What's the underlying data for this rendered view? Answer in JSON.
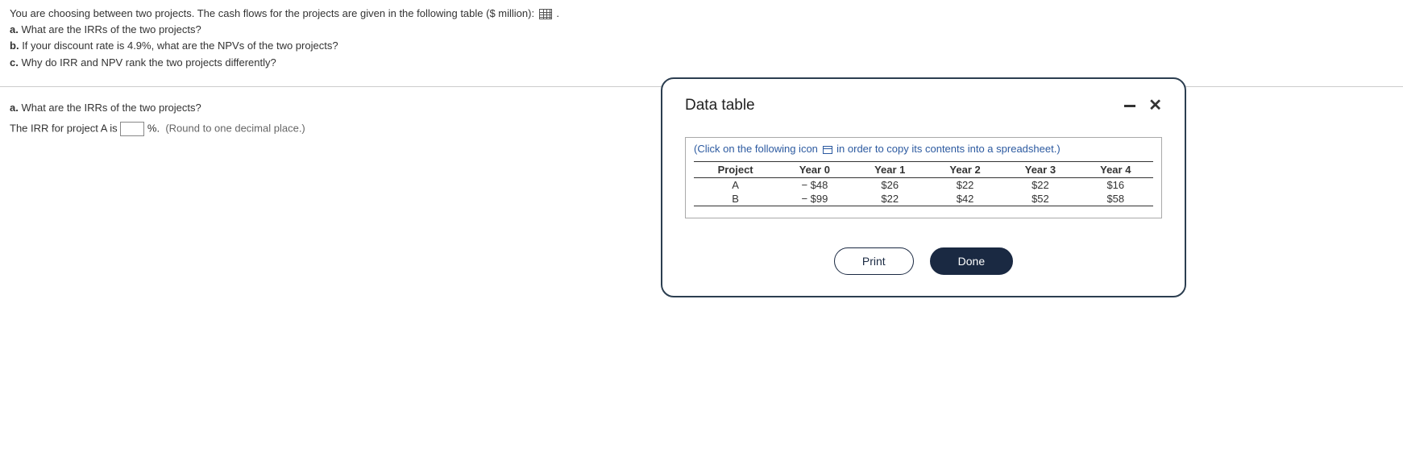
{
  "header": {
    "intro": "You are choosing between two projects. The cash flows for the projects are given in the following table ($ million):",
    "qa_label": "a.",
    "qa_text": "What are the IRRs of the two projects?",
    "qb_label": "b.",
    "qb_text": "If your discount rate is 4.9%, what are the NPVs of the two projects?",
    "qc_label": "c.",
    "qc_text": "Why do IRR and NPV rank the two projects differently?"
  },
  "content": {
    "section_label": "a.",
    "section_text": "What are the IRRs of the two projects?",
    "answer_pre": "The IRR for project A is",
    "answer_post": "%.",
    "hint": "(Round to one decimal place.)",
    "input_value": ""
  },
  "modal": {
    "title": "Data table",
    "copy_hint_pre": "(Click on the following icon",
    "copy_hint_post": "in order to copy its contents into a spreadsheet.)",
    "table": {
      "headers": [
        "Project",
        "Year 0",
        "Year 1",
        "Year 2",
        "Year 3",
        "Year 4"
      ],
      "rows": [
        [
          "A",
          "− $48",
          "$26",
          "$22",
          "$22",
          "$16"
        ],
        [
          "B",
          "− $99",
          "$22",
          "$42",
          "$52",
          "$58"
        ]
      ]
    },
    "print_label": "Print",
    "done_label": "Done"
  },
  "chart_data": {
    "type": "table",
    "title": "Project Cash Flows ($ million)",
    "columns": [
      "Project",
      "Year 0",
      "Year 1",
      "Year 2",
      "Year 3",
      "Year 4"
    ],
    "rows": [
      {
        "Project": "A",
        "Year 0": -48,
        "Year 1": 26,
        "Year 2": 22,
        "Year 3": 22,
        "Year 4": 16
      },
      {
        "Project": "B",
        "Year 0": -99,
        "Year 1": 22,
        "Year 2": 42,
        "Year 3": 52,
        "Year 4": 58
      }
    ]
  }
}
